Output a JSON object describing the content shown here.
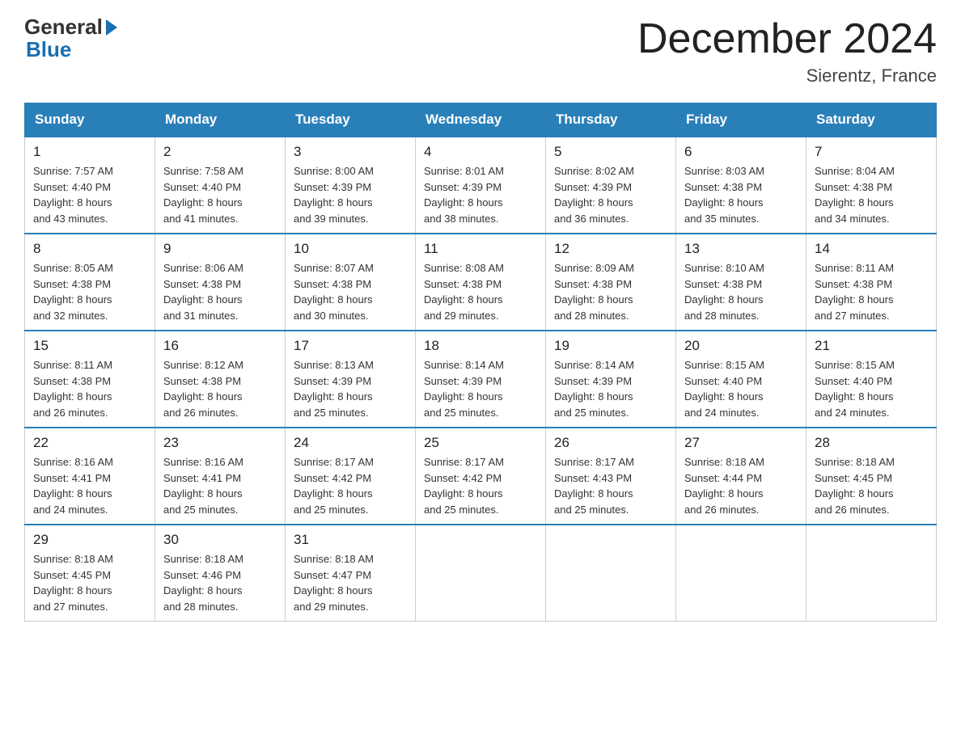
{
  "logo": {
    "line1": "General",
    "arrow": true,
    "line2": "Blue"
  },
  "title": "December 2024",
  "location": "Sierentz, France",
  "days_header": [
    "Sunday",
    "Monday",
    "Tuesday",
    "Wednesday",
    "Thursday",
    "Friday",
    "Saturday"
  ],
  "weeks": [
    [
      {
        "day": 1,
        "sunrise": "7:57 AM",
        "sunset": "4:40 PM",
        "daylight": "8 hours and 43 minutes."
      },
      {
        "day": 2,
        "sunrise": "7:58 AM",
        "sunset": "4:40 PM",
        "daylight": "8 hours and 41 minutes."
      },
      {
        "day": 3,
        "sunrise": "8:00 AM",
        "sunset": "4:39 PM",
        "daylight": "8 hours and 39 minutes."
      },
      {
        "day": 4,
        "sunrise": "8:01 AM",
        "sunset": "4:39 PM",
        "daylight": "8 hours and 38 minutes."
      },
      {
        "day": 5,
        "sunrise": "8:02 AM",
        "sunset": "4:39 PM",
        "daylight": "8 hours and 36 minutes."
      },
      {
        "day": 6,
        "sunrise": "8:03 AM",
        "sunset": "4:38 PM",
        "daylight": "8 hours and 35 minutes."
      },
      {
        "day": 7,
        "sunrise": "8:04 AM",
        "sunset": "4:38 PM",
        "daylight": "8 hours and 34 minutes."
      }
    ],
    [
      {
        "day": 8,
        "sunrise": "8:05 AM",
        "sunset": "4:38 PM",
        "daylight": "8 hours and 32 minutes."
      },
      {
        "day": 9,
        "sunrise": "8:06 AM",
        "sunset": "4:38 PM",
        "daylight": "8 hours and 31 minutes."
      },
      {
        "day": 10,
        "sunrise": "8:07 AM",
        "sunset": "4:38 PM",
        "daylight": "8 hours and 30 minutes."
      },
      {
        "day": 11,
        "sunrise": "8:08 AM",
        "sunset": "4:38 PM",
        "daylight": "8 hours and 29 minutes."
      },
      {
        "day": 12,
        "sunrise": "8:09 AM",
        "sunset": "4:38 PM",
        "daylight": "8 hours and 28 minutes."
      },
      {
        "day": 13,
        "sunrise": "8:10 AM",
        "sunset": "4:38 PM",
        "daylight": "8 hours and 28 minutes."
      },
      {
        "day": 14,
        "sunrise": "8:11 AM",
        "sunset": "4:38 PM",
        "daylight": "8 hours and 27 minutes."
      }
    ],
    [
      {
        "day": 15,
        "sunrise": "8:11 AM",
        "sunset": "4:38 PM",
        "daylight": "8 hours and 26 minutes."
      },
      {
        "day": 16,
        "sunrise": "8:12 AM",
        "sunset": "4:38 PM",
        "daylight": "8 hours and 26 minutes."
      },
      {
        "day": 17,
        "sunrise": "8:13 AM",
        "sunset": "4:39 PM",
        "daylight": "8 hours and 25 minutes."
      },
      {
        "day": 18,
        "sunrise": "8:14 AM",
        "sunset": "4:39 PM",
        "daylight": "8 hours and 25 minutes."
      },
      {
        "day": 19,
        "sunrise": "8:14 AM",
        "sunset": "4:39 PM",
        "daylight": "8 hours and 25 minutes."
      },
      {
        "day": 20,
        "sunrise": "8:15 AM",
        "sunset": "4:40 PM",
        "daylight": "8 hours and 24 minutes."
      },
      {
        "day": 21,
        "sunrise": "8:15 AM",
        "sunset": "4:40 PM",
        "daylight": "8 hours and 24 minutes."
      }
    ],
    [
      {
        "day": 22,
        "sunrise": "8:16 AM",
        "sunset": "4:41 PM",
        "daylight": "8 hours and 24 minutes."
      },
      {
        "day": 23,
        "sunrise": "8:16 AM",
        "sunset": "4:41 PM",
        "daylight": "8 hours and 25 minutes."
      },
      {
        "day": 24,
        "sunrise": "8:17 AM",
        "sunset": "4:42 PM",
        "daylight": "8 hours and 25 minutes."
      },
      {
        "day": 25,
        "sunrise": "8:17 AM",
        "sunset": "4:42 PM",
        "daylight": "8 hours and 25 minutes."
      },
      {
        "day": 26,
        "sunrise": "8:17 AM",
        "sunset": "4:43 PM",
        "daylight": "8 hours and 25 minutes."
      },
      {
        "day": 27,
        "sunrise": "8:18 AM",
        "sunset": "4:44 PM",
        "daylight": "8 hours and 26 minutes."
      },
      {
        "day": 28,
        "sunrise": "8:18 AM",
        "sunset": "4:45 PM",
        "daylight": "8 hours and 26 minutes."
      }
    ],
    [
      {
        "day": 29,
        "sunrise": "8:18 AM",
        "sunset": "4:45 PM",
        "daylight": "8 hours and 27 minutes."
      },
      {
        "day": 30,
        "sunrise": "8:18 AM",
        "sunset": "4:46 PM",
        "daylight": "8 hours and 28 minutes."
      },
      {
        "day": 31,
        "sunrise": "8:18 AM",
        "sunset": "4:47 PM",
        "daylight": "8 hours and 29 minutes."
      },
      null,
      null,
      null,
      null
    ]
  ],
  "labels": {
    "sunrise": "Sunrise:",
    "sunset": "Sunset:",
    "daylight": "Daylight:"
  }
}
